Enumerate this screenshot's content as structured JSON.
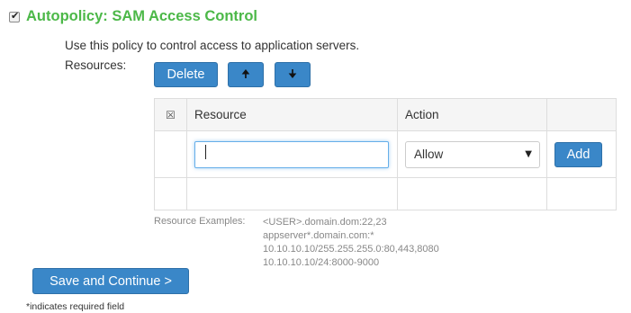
{
  "policy": {
    "enabled": true,
    "title": "Autopolicy: SAM Access Control",
    "description": "Use this policy to control access to application servers.",
    "resources_label": "Resources:"
  },
  "toolbar": {
    "delete_label": "Delete",
    "move_up_icon": "arrow-up-icon",
    "move_down_icon": "arrow-down-icon"
  },
  "table": {
    "headers": [
      "",
      "Resource",
      "Action",
      ""
    ],
    "new_row": {
      "resource_value": "",
      "action_selected": "Allow",
      "add_label": "Add"
    }
  },
  "examples": {
    "label": "Resource Examples:",
    "items": [
      "<USER>.domain.dom:22,23",
      "appserver*.domain.com:*",
      "10.10.10.10/255.255.255.0:80,443,8080",
      "10.10.10.10/24:8000-9000"
    ]
  },
  "footer": {
    "save_label": "Save and Continue >",
    "required_note": "*indicates required field"
  },
  "colors": {
    "title_green": "#4cb848",
    "button_blue": "#3a87c8"
  }
}
